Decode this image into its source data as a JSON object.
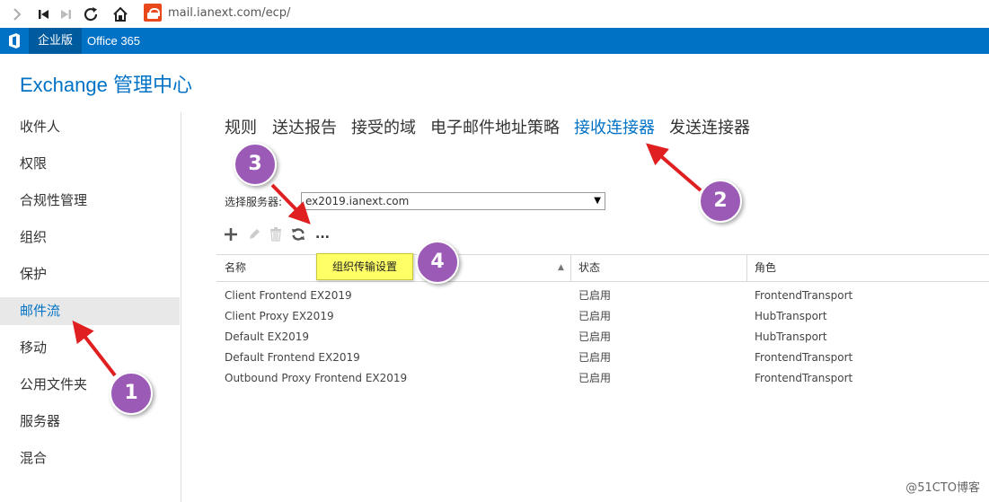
{
  "browser": {
    "url": "mail.ianext.com/ecp/"
  },
  "suite": {
    "enterprise_label": "企业版",
    "product_label": "Office 365"
  },
  "app": {
    "title": "Exchange 管理中心"
  },
  "left_nav": {
    "items": [
      {
        "label": "收件人"
      },
      {
        "label": "权限"
      },
      {
        "label": "合规性管理"
      },
      {
        "label": "组织"
      },
      {
        "label": "保护"
      },
      {
        "label": "邮件流",
        "selected": true
      },
      {
        "label": "移动"
      },
      {
        "label": "公用文件夹"
      },
      {
        "label": "服务器"
      },
      {
        "label": "混合"
      }
    ]
  },
  "tabs": [
    {
      "label": "规则"
    },
    {
      "label": "送达报告"
    },
    {
      "label": "接受的域"
    },
    {
      "label": "电子邮件地址策略"
    },
    {
      "label": "接收连接器",
      "active": true
    },
    {
      "label": "发送连接器"
    }
  ],
  "server_picker": {
    "label": "选择服务器:",
    "value": "ex2019.ianext.com"
  },
  "toolbar": {
    "more_label": "...",
    "more_popup_label": "组织传输设置"
  },
  "table": {
    "columns": [
      "名称",
      "状态",
      "角色"
    ],
    "rows": [
      {
        "name": "Client Frontend EX2019",
        "status": "已启用",
        "role": "FrontendTransport"
      },
      {
        "name": "Client Proxy EX2019",
        "status": "已启用",
        "role": "HubTransport"
      },
      {
        "name": "Default EX2019",
        "status": "已启用",
        "role": "HubTransport"
      },
      {
        "name": "Default Frontend EX2019",
        "status": "已启用",
        "role": "FrontendTransport"
      },
      {
        "name": "Outbound Proxy Frontend EX2019",
        "status": "已启用",
        "role": "FrontendTransport"
      }
    ]
  },
  "annotations": {
    "badge1": "1",
    "badge2": "2",
    "badge3": "3",
    "badge4": "4"
  },
  "watermark": "@51CTO博客",
  "colors": {
    "accent": "#0072c6",
    "suite_bar": "#0072c6",
    "badge": "#9b5ab5",
    "arrow": "#e02020",
    "popup": "#ffff66"
  }
}
